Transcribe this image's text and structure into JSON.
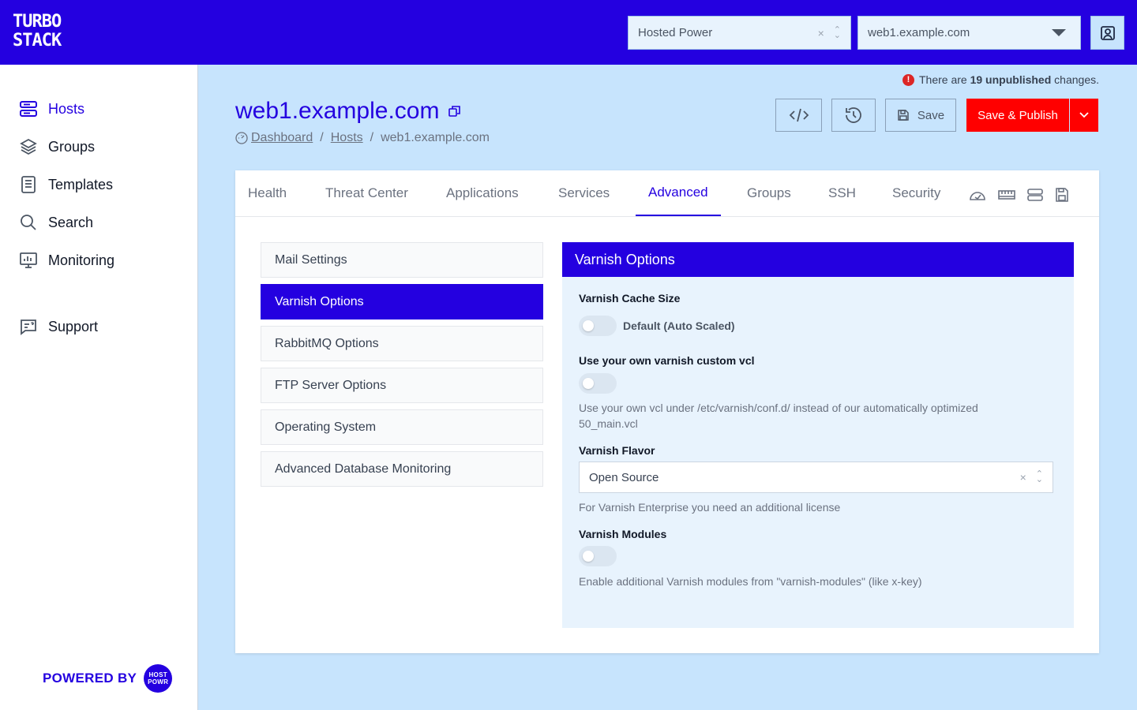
{
  "brand": {
    "logo_line1": "TURBO",
    "logo_line2": "STACK",
    "powered_by": "POWERED BY",
    "powered_logo": "HOSTED POWER"
  },
  "topbar": {
    "org_select": {
      "value": "Hosted Power",
      "clear": "×"
    },
    "host_select": {
      "value": "web1.example.com"
    },
    "user_icon": "user-icon"
  },
  "sidebar": {
    "items": [
      {
        "label": "Hosts",
        "icon": "server-icon",
        "active": true
      },
      {
        "label": "Groups",
        "icon": "layers-icon"
      },
      {
        "label": "Templates",
        "icon": "document-icon"
      },
      {
        "label": "Search",
        "icon": "search-icon"
      },
      {
        "label": "Monitoring",
        "icon": "monitor-icon"
      },
      {
        "label": "Support",
        "icon": "chat-icon"
      }
    ]
  },
  "notice": {
    "prefix": "There are",
    "count": "19 unpublished",
    "suffix": "changes."
  },
  "header": {
    "title": "web1.example.com",
    "breadcrumb": [
      "Dashboard",
      "Hosts",
      "web1.example.com"
    ],
    "save_label": "Save",
    "publish_label": "Save & Publish"
  },
  "tabs": [
    {
      "label": "Health"
    },
    {
      "label": "Threat Center"
    },
    {
      "label": "Applications"
    },
    {
      "label": "Services"
    },
    {
      "label": "Advanced",
      "active": true
    },
    {
      "label": "Groups"
    },
    {
      "label": "SSH"
    },
    {
      "label": "Security"
    }
  ],
  "tab_icons": [
    "dashboard-gauge-icon",
    "memory-icon",
    "server-icon",
    "floppy-icon"
  ],
  "advanced_menu": [
    {
      "label": "Mail Settings"
    },
    {
      "label": "Varnish Options",
      "active": true
    },
    {
      "label": "RabbitMQ Options"
    },
    {
      "label": "FTP Server Options"
    },
    {
      "label": "Operating System"
    },
    {
      "label": "Advanced Database Monitoring"
    }
  ],
  "panel": {
    "title": "Varnish Options",
    "cache_size": {
      "label": "Varnish Cache Size",
      "toggle_text": "Default (Auto Scaled)",
      "on": false
    },
    "custom_vcl": {
      "label": "Use your own varnish custom vcl",
      "on": false,
      "help": "Use your own vcl under /etc/varnish/conf.d/ instead of our automatically optimized 50_main.vcl"
    },
    "flavor": {
      "label": "Varnish Flavor",
      "value": "Open Source",
      "clear": "×",
      "help": "For Varnish Enterprise you need an additional license"
    },
    "modules": {
      "label": "Varnish Modules",
      "on": false,
      "help": "Enable additional Varnish modules from \"varnish-modules\" (like x-key)"
    }
  },
  "colors": {
    "brand": "#2400e0",
    "danger": "#ff0000",
    "background": "#c7e4fd"
  }
}
